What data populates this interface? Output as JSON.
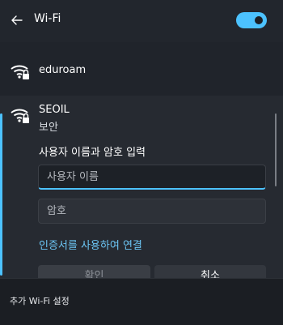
{
  "header": {
    "title": "Wi-Fi",
    "back_icon": "back-arrow-icon",
    "toggle_state": "on"
  },
  "networks": [
    {
      "name": "eduroam",
      "icon": "wifi-secured-icon"
    },
    {
      "name": "SEOIL",
      "status": "보안",
      "icon": "wifi-secured-icon"
    }
  ],
  "login": {
    "prompt": "사용자 이름과 암호 입력",
    "username_placeholder": "사용자 이름",
    "password_placeholder": "암호",
    "cert_link": "인증서를 사용하여 연결",
    "connect_label": "확인",
    "cancel_label": "취소"
  },
  "footer": {
    "more_settings": "추가 Wi-Fi 설정"
  },
  "colors": {
    "accent": "#4cc2ff",
    "background": "#20242b",
    "link": "#6cc6f5"
  }
}
